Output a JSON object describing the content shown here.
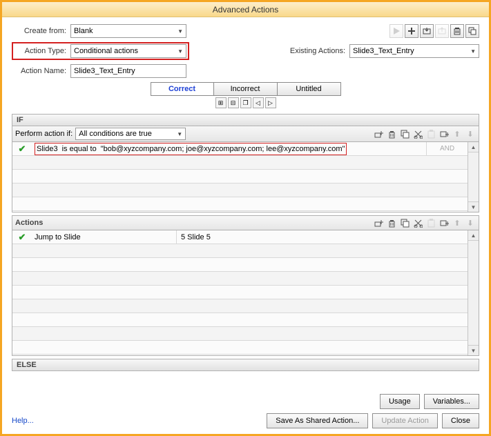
{
  "window": {
    "title": "Advanced Actions"
  },
  "top": {
    "create_from_label": "Create from:",
    "create_from_value": "Blank",
    "action_type_label": "Action Type:",
    "action_type_value": "Conditional actions",
    "action_name_label": "Action Name:",
    "action_name_value": "Slide3_Text_Entry",
    "existing_actions_label": "Existing Actions:",
    "existing_actions_value": "Slide3_Text_Entry"
  },
  "tabs": [
    "Correct",
    "Incorrect",
    "Untitled"
  ],
  "active_tab": 0,
  "if_section": {
    "header": "IF",
    "perform_label": "Perform action if:",
    "perform_value": "All conditions are true",
    "condition": {
      "variable": "Slide3",
      "operator": "is equal to",
      "value": "\"bob@xyzcompany.com; joe@xyzcompany.com; lee@xyzcompany.com\"",
      "join": "AND"
    }
  },
  "actions_section": {
    "header": "Actions",
    "row": {
      "action": "Jump to Slide",
      "target": "5 Slide 5"
    }
  },
  "else_section": {
    "header": "ELSE"
  },
  "buttons": {
    "usage": "Usage",
    "variables": "Variables...",
    "save_shared": "Save As Shared Action...",
    "update": "Update Action",
    "close": "Close",
    "help": "Help..."
  }
}
